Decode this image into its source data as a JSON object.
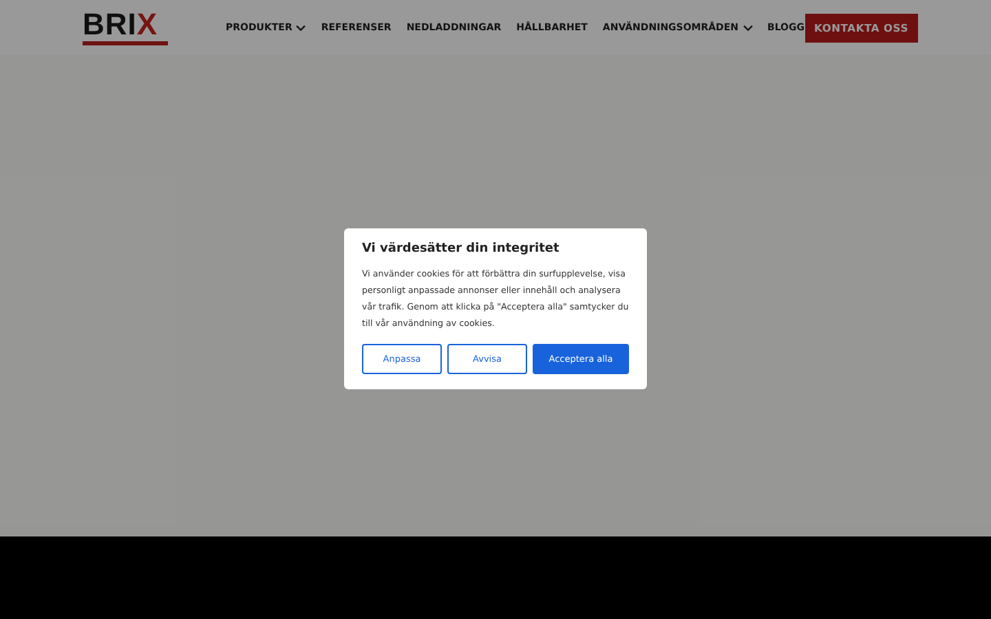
{
  "header": {
    "logo": {
      "text": "BRI",
      "accent": "X"
    },
    "nav": [
      {
        "label": "PRODUKTER",
        "has_dropdown": true
      },
      {
        "label": "REFERENSER",
        "has_dropdown": false
      },
      {
        "label": "NEDLADDNINGAR",
        "has_dropdown": false
      },
      {
        "label": "HÅLLBARHET",
        "has_dropdown": false
      },
      {
        "label": "ANVÄNDNINGSOMRÅDEN",
        "has_dropdown": true
      },
      {
        "label": "BLOGG",
        "has_dropdown": false
      }
    ],
    "cta": "KONTAKTA OSS"
  },
  "cookie_dialog": {
    "title": "Vi värdesätter din integritet",
    "text": "Vi använder cookies för att förbättra din surfupplevelse, visa personligt anpassade annonser eller innehåll och analysera vår trafik. Genom att klicka på \"Acceptera alla\" samtycker du till vår användning av cookies.",
    "buttons": [
      {
        "label": "Anpassa",
        "kind": "outline"
      },
      {
        "label": "Avvisa",
        "kind": "outline"
      },
      {
        "label": "Acceptera alla",
        "kind": "primary"
      }
    ]
  }
}
